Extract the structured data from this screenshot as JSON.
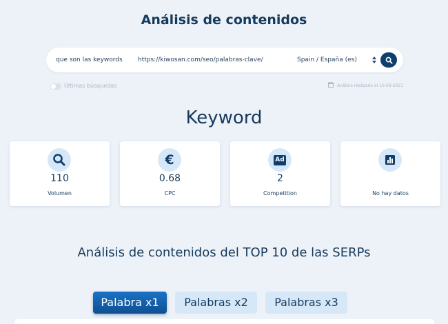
{
  "header": {
    "title": "Análisis de contenidos"
  },
  "search": {
    "keyword": "que son las keywords",
    "url": "https://kiwosan.com/seo/palabras-clave/",
    "country": "Spain / España (es)"
  },
  "options": {
    "recent_label": "Últimas búsquedas",
    "analysis_date": "Análisis realizado el 16-03-2021"
  },
  "keyword_section": {
    "heading": "Keyword",
    "cards": [
      {
        "icon": "search-icon",
        "value": "110",
        "label": "Volumen"
      },
      {
        "icon": "euro-icon",
        "value": "0.68",
        "label": "CPC"
      },
      {
        "icon": "ad-icon",
        "value": "2",
        "label": "Competition"
      },
      {
        "icon": "bar-chart-icon",
        "value": "",
        "label": "No hay datos"
      }
    ]
  },
  "serp_section": {
    "heading": "Análisis de contenidos del TOP 10 de las SERPs",
    "tabs": [
      "Palabra x1",
      "Palabras x2",
      "Palabras x3"
    ],
    "active_tab": "Palabra x1"
  },
  "colors": {
    "background": "#edf2f8",
    "primary_dark": "#163a5c",
    "accent": "#1b72c6",
    "icon_bg": "#d6e8f7"
  }
}
